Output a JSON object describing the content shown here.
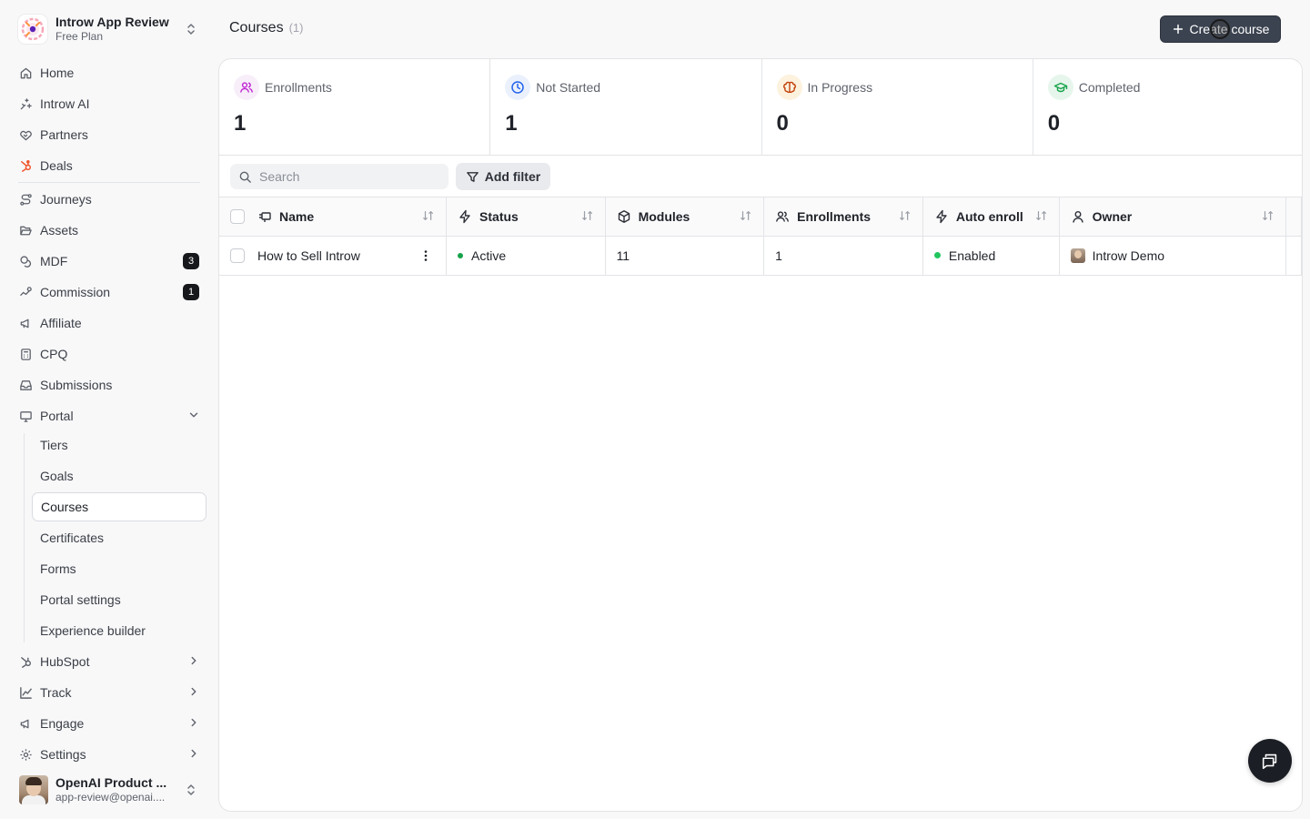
{
  "workspace": {
    "name": "Introw App Review",
    "plan": "Free Plan"
  },
  "nav": {
    "home": "Home",
    "introw_ai": "Introw AI",
    "partners": "Partners",
    "deals": "Deals",
    "journeys": "Journeys",
    "assets": "Assets",
    "mdf": "MDF",
    "mdf_badge": "3",
    "commission": "Commission",
    "commission_badge": "1",
    "affiliate": "Affiliate",
    "cpq": "CPQ",
    "submissions": "Submissions",
    "portal": "Portal",
    "portal_sub": {
      "tiers": "Tiers",
      "goals": "Goals",
      "courses": "Courses",
      "certificates": "Certificates",
      "forms": "Forms",
      "portal_settings": "Portal settings",
      "experience_builder": "Experience builder"
    },
    "hubspot": "HubSpot",
    "track": "Track",
    "engage": "Engage",
    "settings": "Settings"
  },
  "user": {
    "name": "OpenAI Product ...",
    "email": "app-review@openai...."
  },
  "header": {
    "title": "Courses",
    "count": "(1)",
    "create_label": "Create course"
  },
  "stats": [
    {
      "label": "Enrollments",
      "value": "1",
      "color": "#c026d3",
      "bg": "#f7eefa"
    },
    {
      "label": "Not Started",
      "value": "1",
      "color": "#2563eb",
      "bg": "#eaf1fc"
    },
    {
      "label": "In Progress",
      "value": "0",
      "color": "#c2410c",
      "bg": "#fdf2de"
    },
    {
      "label": "Completed",
      "value": "0",
      "color": "#16a34a",
      "bg": "#e6f6ec"
    }
  ],
  "toolbar": {
    "search_placeholder": "Search",
    "filter_label": "Add filter"
  },
  "table": {
    "columns": {
      "name": "Name",
      "status": "Status",
      "modules": "Modules",
      "enrollments": "Enrollments",
      "auto_enroll": "Auto enroll",
      "owner": "Owner"
    },
    "rows": [
      {
        "name": "How to Sell Introw",
        "status": "Active",
        "modules": "11",
        "enrollments": "1",
        "auto_enroll": "Enabled",
        "owner": "Introw Demo"
      }
    ]
  },
  "colors": {
    "status_active": "#16a34a",
    "auto_enabled": "#22c55e",
    "primary_button": "#3b4350"
  }
}
